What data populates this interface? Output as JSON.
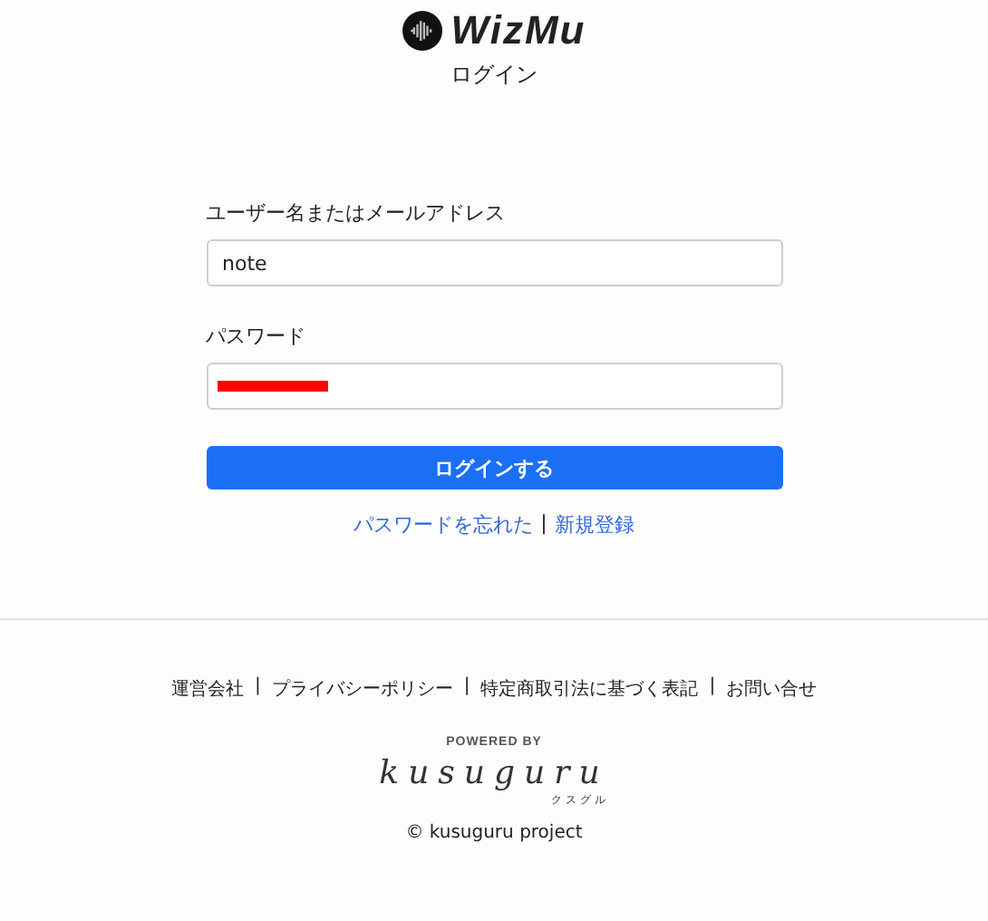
{
  "header": {
    "logo_text": "WizMu",
    "title": "ログイン"
  },
  "form": {
    "fields": [
      {
        "label": "ユーザー名またはメールアドレス",
        "value": "note",
        "redacted": false
      },
      {
        "label": "パスワード",
        "redacted": true
      }
    ],
    "submit": "ログインする",
    "links": [
      {
        "label": "パスワードを忘れた"
      },
      {
        "label": "新規登録"
      }
    ],
    "link_separator": "|"
  },
  "footer": {
    "links": [
      "運営会社",
      "プライバシーポリシー",
      "特定商取引法に基づく表記",
      "お問い合せ"
    ],
    "separator": "|",
    "powered_by": "POWERED BY",
    "brand": "kusuguru",
    "brand_kana": "クスグル",
    "copyright": "© kusuguru project"
  }
}
